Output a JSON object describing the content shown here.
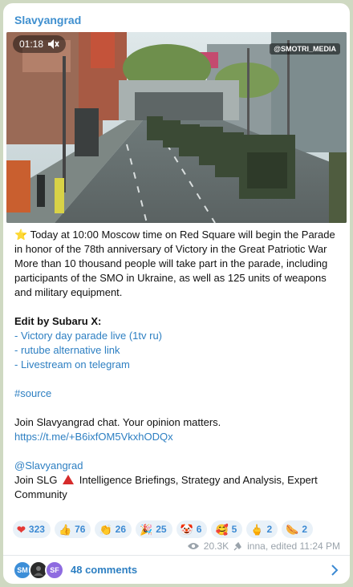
{
  "channel": {
    "name": "Slavyangrad"
  },
  "video": {
    "timestamp": "01:18",
    "mute_icon": "speaker-muted-icon",
    "watermark": "@SMOTRI_MEDIA"
  },
  "post": {
    "line1": "Today at 10:00 Moscow time on Red Square will begin  the Parade in honor of the 78th anniversary of Victory in the Great Patriotic War",
    "line2": "More than 10 thousand people will take part in the parade, including participants of the SMO in Ukraine, as well as 125 units of weapons and military equipment.",
    "edit_heading": "Edit by Subaru X:",
    "links": [
      "- Victory day parade live (1tv ru)",
      "- rutube alternative link",
      "- Livestream on telegram"
    ],
    "hashtag": "#source",
    "join_chat": "Join Slavyangrad chat. Your opinion matters.",
    "chat_url": "https://t.me/+B6ixfOM5VkxhODQx",
    "handle": "@Slavyangrad",
    "slg_prefix": "Join SLG",
    "slg_suffix": "Intelligence Briefings, Strategy and Analysis, Expert Community"
  },
  "reactions": [
    {
      "emoji": "❤",
      "icon": "heart-icon",
      "count": "323"
    },
    {
      "emoji": "👍",
      "icon": "thumbs-up-icon",
      "count": "76"
    },
    {
      "emoji": "👏",
      "icon": "clap-icon",
      "count": "26"
    },
    {
      "emoji": "🎉",
      "icon": "party-popper-icon",
      "count": "25"
    },
    {
      "emoji": "🤡",
      "icon": "clown-icon",
      "count": "6"
    },
    {
      "emoji": "🥰",
      "icon": "hearts-face-icon",
      "count": "5"
    },
    {
      "emoji": "🖕",
      "icon": "middle-finger-icon",
      "count": "2"
    },
    {
      "emoji": "🌭",
      "icon": "hotdog-icon",
      "count": "2"
    }
  ],
  "meta": {
    "views": "20.3K",
    "edited": "inna, edited 11:24 PM"
  },
  "comments": {
    "label": "48 comments",
    "avatars": [
      "SM",
      "",
      "SF"
    ]
  },
  "colors": {
    "link": "#2d7fc2",
    "reaction_bg": "#e9f1f8",
    "reaction_text": "#3c8ad3"
  }
}
